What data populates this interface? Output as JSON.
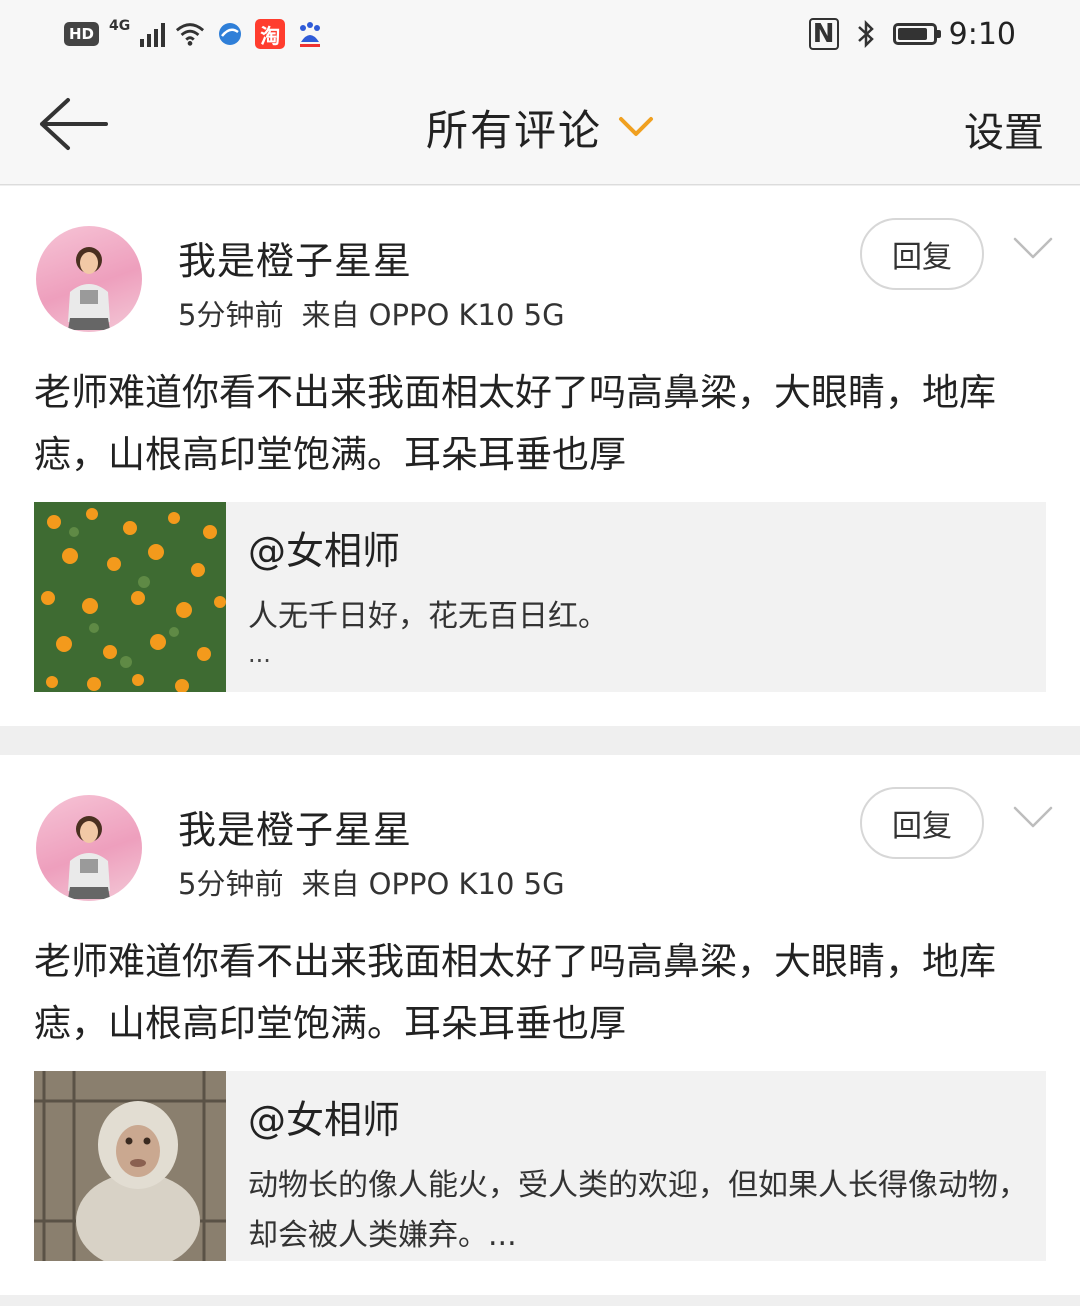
{
  "status_bar": {
    "hd_label": "HD",
    "network_label": "4G",
    "taobao_label": "淘",
    "nfc_label": "N",
    "battery_level": 0.85,
    "time": "9:10"
  },
  "header": {
    "title": "所有评论",
    "settings_label": "设置"
  },
  "comments": [
    {
      "username": "我是橙子星星",
      "time_ago": "5分钟前",
      "source": "来自 OPPO K10 5G",
      "reply_label": "回复",
      "text": "老师难道你看不出来我面相太好了吗高鼻梁，大眼睛，地库痣，山根高印堂饱满。耳朵耳垂也厚",
      "quote": {
        "author": "@女相师",
        "text": "人无千日好，花无百日红。",
        "ellipsis": "..."
      }
    },
    {
      "username": "我是橙子星星",
      "time_ago": "5分钟前",
      "source": "来自 OPPO K10 5G",
      "reply_label": "回复",
      "text": "老师难道你看不出来我面相太好了吗高鼻梁，大眼睛，地库痣，山根高印堂饱满。耳朵耳垂也厚",
      "quote": {
        "author": "@女相师",
        "text": "动物长的像人能火，受人类的欢迎，但如果人长得像动物，却会被人类嫌弃。..."
      }
    }
  ]
}
